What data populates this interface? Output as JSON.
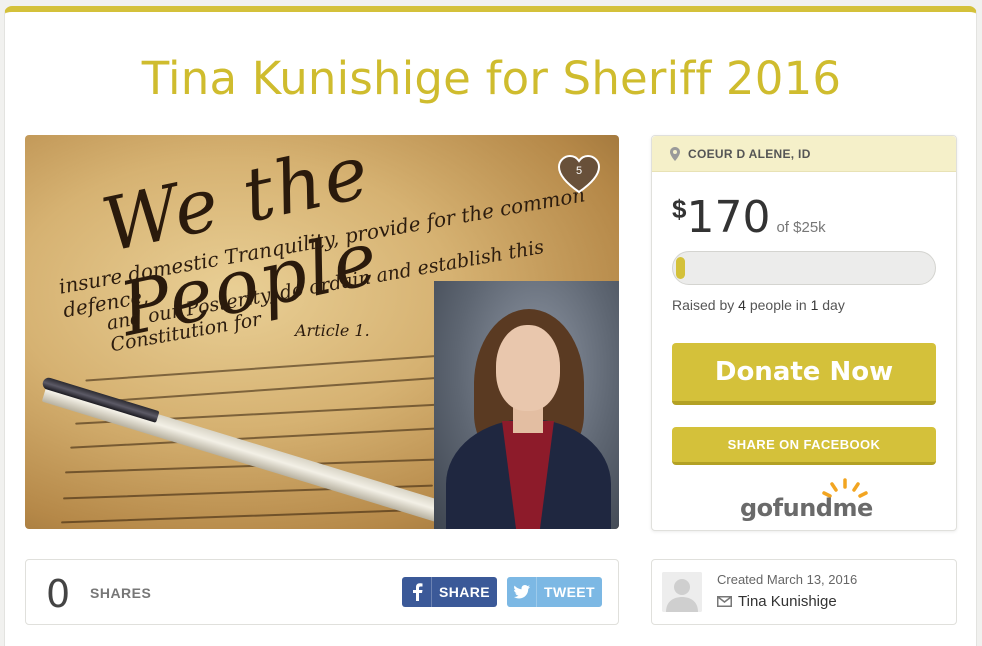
{
  "campaign": {
    "title": "Tina Kunishige for Sheriff 2016",
    "likes": "5",
    "location": "COEUR D ALENE, ID",
    "currency": "$",
    "raised": "170",
    "goal_text": "of $25k",
    "progress_fraction": 0.0068,
    "raised_prefix": "Raised by",
    "donor_count": "4",
    "raised_mid": "people in",
    "days": "1",
    "raised_suffix": "day",
    "donate_label": "Donate Now",
    "share_facebook_label": "SHARE ON FACEBOOK",
    "logo_go": "go",
    "logo_fund": "fund",
    "logo_me": "me"
  },
  "hero_image": {
    "script_heading": "We the People",
    "script_line_1": "insure domestic Tranquility, provide for the common defence,",
    "script_line_2": "and our Posterity, do ordain and establish this Constitution for",
    "script_line_3": "Article 1."
  },
  "share_bar": {
    "count": "0",
    "label": "SHARES",
    "facebook_label": "SHARE",
    "twitter_label": "TWEET"
  },
  "organizer": {
    "created": "Created March 13, 2016",
    "name": "Tina Kunishige"
  },
  "colors": {
    "accent": "#d4c13a",
    "title": "#cfbc2e",
    "facebook": "#3b5998",
    "twitter": "#7cb8e4",
    "location_bar": "#f5f0c9"
  },
  "icons": {
    "location": "map-pin-icon",
    "like": "heart-icon",
    "facebook": "facebook-icon",
    "twitter": "twitter-bird-icon",
    "email": "envelope-icon",
    "avatar": "person-silhouette-icon"
  }
}
